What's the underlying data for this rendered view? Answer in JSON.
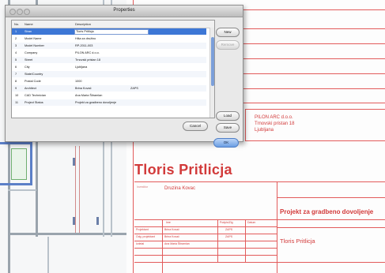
{
  "dialog": {
    "title": "Properties",
    "columns": {
      "no": "No.",
      "name": "Name",
      "description": "Description"
    },
    "rows": [
      {
        "no": "1",
        "name": "Stran",
        "description": "Tloris Pritlicja"
      },
      {
        "no": "2",
        "name": "Model Name",
        "description": "Hiša za družino"
      },
      {
        "no": "3",
        "name": "Model Number",
        "description": "RP-2011-003"
      },
      {
        "no": "4",
        "name": "Company",
        "description": "PILON ARC d.o.o."
      },
      {
        "no": "5",
        "name": "Street",
        "description": "Trnovski pristan 18"
      },
      {
        "no": "6",
        "name": "City",
        "description": "Ljubljana"
      },
      {
        "no": "7",
        "name": "State/Country",
        "description": ""
      },
      {
        "no": "8",
        "name": "Postal Code",
        "description": "1000"
      },
      {
        "no": "9",
        "name": "Architect",
        "description": "Brina Kovač",
        "extra": "ZAPS"
      },
      {
        "no": "10",
        "name": "CAD Technician",
        "description": "Ana Maria Štiramlan"
      },
      {
        "no": "11",
        "name": "Project Status",
        "description": "Projekt za gradbeno dovoljenje"
      }
    ],
    "buttons": {
      "new": "New",
      "remove": "Remove",
      "load": "Load",
      "save": "Save",
      "cancel": "Cancel",
      "ok": "OK"
    }
  },
  "sheet": {
    "company_block": [
      "PILON ARC d.o.o.",
      "Trnovski pristan 18",
      "Ljubljana"
    ],
    "title": "Tloris Pritlicja",
    "investor_label": "Investitor",
    "investor_value": "Druzina Kovac",
    "project_value": "Projekt za gradbeno dovoljenje",
    "drawing_value": "Tloris Pritlicja",
    "table_rows": [
      {
        "c1": "",
        "c2": "Ime",
        "c3": "Podpis/Zig",
        "c4": "Datum"
      },
      {
        "c1": "Projektant",
        "c2": "Brina Kovač",
        "c3": "ZAPS",
        "c4": ""
      },
      {
        "c1": "Odg. projektant",
        "c2": "Brina Kovač",
        "c3": "ZAPS",
        "c4": ""
      },
      {
        "c1": "Izdelal",
        "c2": "Ana Maria Štiramlan",
        "c3": "",
        "c4": ""
      }
    ]
  }
}
